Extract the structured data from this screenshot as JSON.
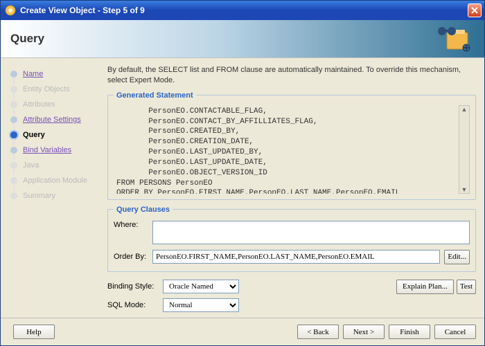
{
  "window": {
    "title": "Create View Object - Step 5 of 9"
  },
  "banner": {
    "heading": "Query"
  },
  "steps": [
    {
      "label": "Name",
      "state": "link"
    },
    {
      "label": "Entity Objects",
      "state": "disabled"
    },
    {
      "label": "Attributes",
      "state": "disabled"
    },
    {
      "label": "Attribute Settings",
      "state": "link"
    },
    {
      "label": "Query",
      "state": "active"
    },
    {
      "label": "Bind Variables",
      "state": "link"
    },
    {
      "label": "Java",
      "state": "disabled"
    },
    {
      "label": "Application Module",
      "state": "disabled"
    },
    {
      "label": "Summary",
      "state": "disabled"
    }
  ],
  "intro": "By default, the SELECT list and FROM clause are automatically maintained.  To override this mechanism, select Expert Mode.",
  "generated": {
    "legend": "Generated Statement",
    "sql": "       PersonEO.CONTACTABLE_FLAG,\n       PersonEO.CONTACT_BY_AFFILLIATES_FLAG,\n       PersonEO.CREATED_BY,\n       PersonEO.CREATION_DATE,\n       PersonEO.LAST_UPDATED_BY,\n       PersonEO.LAST_UPDATE_DATE,\n       PersonEO.OBJECT_VERSION_ID\nFROM PERSONS PersonEO\nORDER BY PersonEO.FIRST_NAME,PersonEO.LAST_NAME,PersonEO.EMAIL"
  },
  "clauses": {
    "legend": "Query Clauses",
    "where_label": "Where:",
    "where_value": "",
    "orderby_label": "Order By:",
    "orderby_value": "PersonEO.FIRST_NAME,PersonEO.LAST_NAME,PersonEO.EMAIL",
    "edit_btn": "Edit..."
  },
  "binding": {
    "label": "Binding Style:",
    "selected": "Oracle Named",
    "explain_btn": "Explain Plan...",
    "test_btn": "Test"
  },
  "sqlmode": {
    "label": "SQL Mode:",
    "selected": "Normal"
  },
  "footer": {
    "help": "Help",
    "back": "< Back",
    "next": "Next >",
    "finish": "Finish",
    "cancel": "Cancel"
  }
}
